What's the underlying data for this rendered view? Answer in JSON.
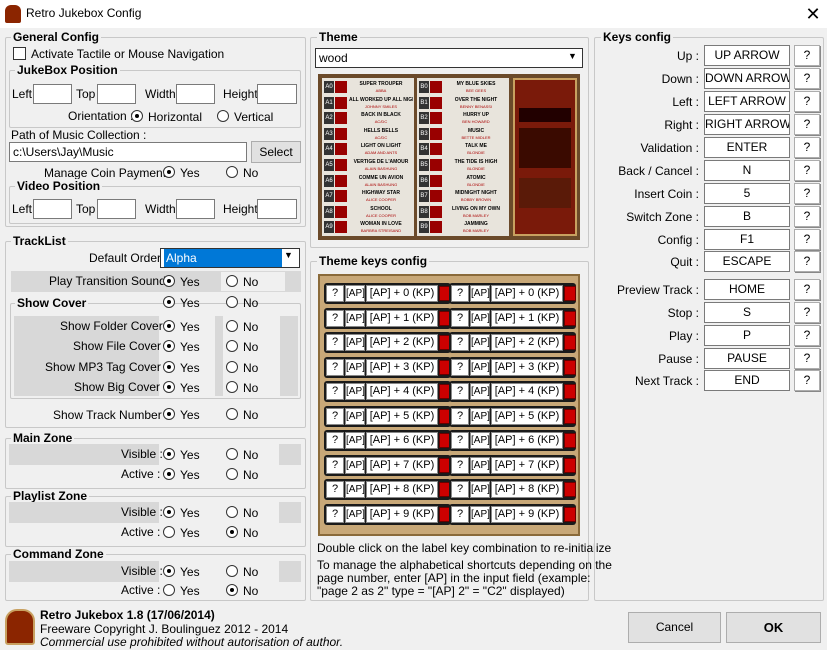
{
  "window": {
    "title": "Retro Jukebox Config",
    "close_glyph": "✕"
  },
  "general": {
    "title": "General Config",
    "tactile_label": "Activate Tactile or Mouse Navigation",
    "jukebox_position": {
      "title": "JukeBox Position",
      "left": "Left",
      "top": "Top",
      "width": "Width",
      "height": "Height"
    },
    "orientation": {
      "label": "Orientation :",
      "horizontal": "Horizontal",
      "vertical": "Vertical"
    },
    "path_label": "Path of Music Collection :",
    "path_value": "c:\\Users\\Jay\\Music",
    "select_button": "Select",
    "coin": {
      "label": "Manage Coin Payment :",
      "yes": "Yes",
      "no": "No"
    },
    "video_position": {
      "title": "Video Position",
      "left": "Left",
      "top": "Top",
      "width": "Width",
      "height": "Height"
    }
  },
  "tracklist": {
    "title": "TrackList",
    "default_order_label": "Default Order :",
    "default_order_value": "Alpha",
    "play_transition_label": "Play Transition Sound :",
    "show_cover_label": "Show Cover",
    "show_folder_cover": "Show Folder Cover :",
    "show_file_cover": "Show File Cover :",
    "show_mp3_cover": "Show MP3 Tag Cover :",
    "show_big_cover": "Show Big Cover :",
    "show_track_number": "Show Track Number :",
    "yes": "Yes",
    "no": "No"
  },
  "main_zone": {
    "title": "Main Zone",
    "visible": "Visible :",
    "active": "Active :",
    "yes": "Yes",
    "no": "No"
  },
  "playlist_zone": {
    "title": "Playlist Zone",
    "visible": "Visible :",
    "active": "Active :",
    "yes": "Yes",
    "no": "No"
  },
  "command_zone": {
    "title": "Command Zone",
    "visible": "Visible :",
    "active": "Active :",
    "yes": "Yes",
    "no": "No"
  },
  "theme": {
    "title": "Theme",
    "selected": "wood",
    "preview_left": [
      {
        "code": "A0",
        "title": "SUPER TROUPER",
        "artist": "ABBA"
      },
      {
        "code": "A1",
        "title": "ALL WORKED UP ALL NIGHT",
        "artist": "JOHNNY SMILES"
      },
      {
        "code": "A2",
        "title": "BACK IN BLACK",
        "artist": "AC/DC"
      },
      {
        "code": "A3",
        "title": "HELLS BELLS",
        "artist": "AC/DC"
      },
      {
        "code": "A4",
        "title": "LIGHT ON LIGHT",
        "artist": "ADAM AND ANTS"
      },
      {
        "code": "A5",
        "title": "VERTIGE DE L'AMOUR",
        "artist": "ALAIN BASHUNG"
      },
      {
        "code": "A6",
        "title": "COMME UN AVION",
        "artist": "ALAIN BASHUNG"
      },
      {
        "code": "A7",
        "title": "HIGHWAY STAR",
        "artist": "ALICE COOPER"
      },
      {
        "code": "A8",
        "title": "SCHOOL",
        "artist": "ALICE COOPER"
      },
      {
        "code": "A9",
        "title": "WOMAN IN LOVE",
        "artist": "BARBRA STREISAND"
      }
    ],
    "preview_right": [
      {
        "code": "B0",
        "title": "MY BLUE SKIES",
        "artist": "BEE GEES"
      },
      {
        "code": "B1",
        "title": "OVER THE NIGHT",
        "artist": "BENNY BENASSI"
      },
      {
        "code": "B2",
        "title": "HURRY UP",
        "artist": "BEN HOWARD"
      },
      {
        "code": "B3",
        "title": "MUSIC",
        "artist": "BETTE MIDLER"
      },
      {
        "code": "B4",
        "title": "TALK ME",
        "artist": "BLONDIE"
      },
      {
        "code": "B5",
        "title": "THE TIDE IS HIGH",
        "artist": "BLONDIE"
      },
      {
        "code": "B6",
        "title": "ATOMIC",
        "artist": "BLONDIE"
      },
      {
        "code": "B7",
        "title": "MIDNIGHT NIGHT",
        "artist": "BOBBY BROWN"
      },
      {
        "code": "B8",
        "title": "LIVING ON MY OWN",
        "artist": "BOB MARLEY"
      },
      {
        "code": "B9",
        "title": "JAMMING",
        "artist": "BOB MARLEY"
      }
    ]
  },
  "theme_keys": {
    "title": "Theme keys config",
    "rows": [
      "[AP] + 0 (KP)",
      "[AP] + 1 (KP)",
      "[AP] + 2 (KP)",
      "[AP] + 3 (KP)",
      "[AP] + 4 (KP)",
      "[AP] + 5 (KP)",
      "[AP] + 6 (KP)",
      "[AP] + 7 (KP)",
      "[AP] + 8 (KP)",
      "[AP] + 9 (KP)"
    ],
    "q_glyph": "?",
    "ap_glyph": "[AP]",
    "hint1": "Double click on the label key combination to re-initialize",
    "hint2_line1": "To manage the alphabetical shortcuts depending on the",
    "hint2_line2": "page number, enter [AP] in the input field (example:",
    "hint2_line3": "\"page 2 as 2\" type = \"[AP] 2\" = \"C2\" displayed)"
  },
  "keys": {
    "title": "Keys config",
    "help_glyph": "?",
    "items": [
      {
        "label": "Up :",
        "value": "UP ARROW"
      },
      {
        "label": "Down :",
        "value": "DOWN ARROW"
      },
      {
        "label": "Left :",
        "value": "LEFT ARROW"
      },
      {
        "label": "Right :",
        "value": "RIGHT ARROW"
      },
      {
        "label": "Validation :",
        "value": "ENTER"
      },
      {
        "label": "Back / Cancel :",
        "value": "N"
      },
      {
        "label": "Insert Coin :",
        "value": "5"
      },
      {
        "label": "Switch Zone :",
        "value": "B"
      },
      {
        "label": "Config :",
        "value": "F1"
      },
      {
        "label": "Quit :",
        "value": "ESCAPE"
      },
      {
        "label": "Preview Track :",
        "value": "HOME"
      },
      {
        "label": "Stop :",
        "value": "S"
      },
      {
        "label": "Play :",
        "value": "P"
      },
      {
        "label": "Pause :",
        "value": "PAUSE"
      },
      {
        "label": "Next Track :",
        "value": "END"
      }
    ]
  },
  "footer": {
    "app_name": "Retro Jukebox 1.8 (17/06/2014)",
    "copyright": "Freeware Copyright J. Boulinguez 2012 - 2014",
    "notice": "Commercial use prohibited without autorisation of author.",
    "cancel": "Cancel",
    "ok": "OK"
  },
  "colors": {
    "accent": "#0078d7",
    "selected_bg": "#0078d7",
    "grey_panel": "#d8d8d8"
  }
}
